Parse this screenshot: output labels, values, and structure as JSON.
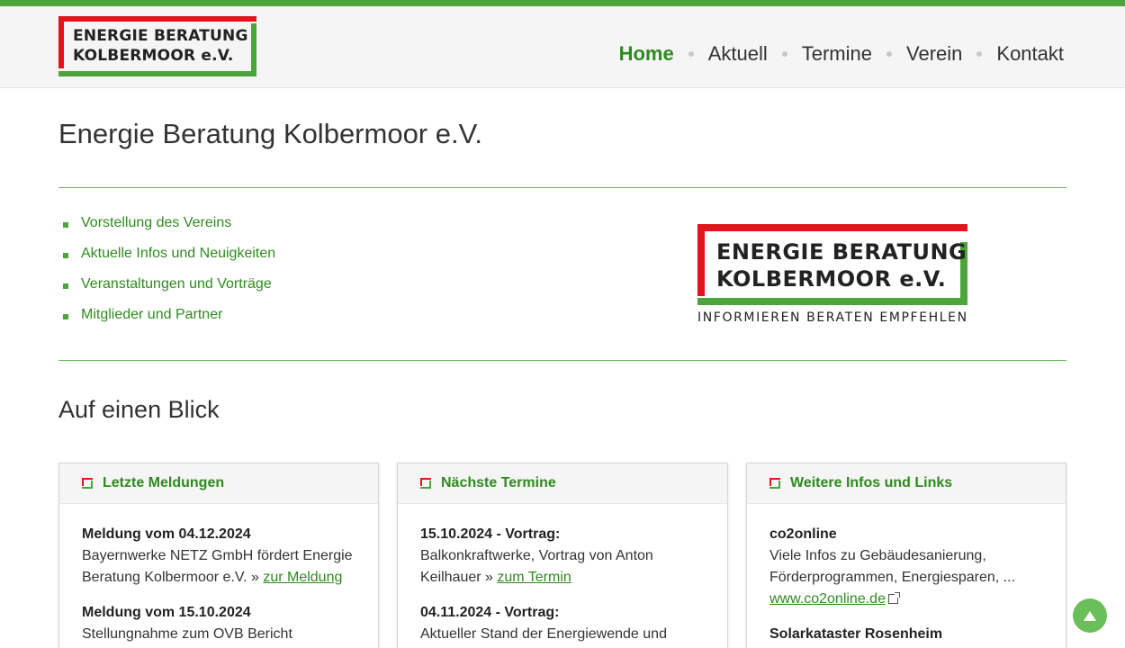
{
  "header": {
    "logo_line1": "ENERGIE BERATUNG",
    "logo_line2": "KOLBERMOOR e.V.",
    "nav": [
      {
        "label": "Home",
        "active": true
      },
      {
        "label": "Aktuell",
        "active": false
      },
      {
        "label": "Termine",
        "active": false
      },
      {
        "label": "Verein",
        "active": false
      },
      {
        "label": "Kontakt",
        "active": false
      }
    ]
  },
  "main": {
    "title": "Energie Beratung Kolbermoor e.V.",
    "intro_links": [
      "Vorstellung des Vereins",
      "Aktuelle Infos und Neuigkeiten",
      "Veranstaltungen und Vorträge",
      "Mitglieder und Partner"
    ],
    "logo": {
      "line1": "ENERGIE BERATUNG",
      "line2": "KOLBERMOOR e.V.",
      "slogan": "INFORMIEREN BERATEN EMPFEHLEN"
    },
    "section_title": "Auf einen Blick"
  },
  "cards": {
    "news": {
      "title": "Letzte Meldungen",
      "entries": [
        {
          "heading": "Meldung vom 04.12.2024",
          "text": "Bayernwerke NETZ GmbH fördert Energie Beratung Kolbermoor e.V. » ",
          "link": "zur Meldung"
        },
        {
          "heading": "Meldung vom 15.10.2024",
          "text": "Stellungnahme zum OVB Bericht"
        }
      ]
    },
    "events": {
      "title": "Nächste Termine",
      "entries": [
        {
          "heading": "15.10.2024 - Vortrag:",
          "text": "Balkonkraftwerke, Vortrag von Anton Keilhauer » ",
          "link": "zum Termin"
        },
        {
          "heading": "04.11.2024 - Vortrag:",
          "text": "Aktueller Stand der Energiewende und"
        }
      ]
    },
    "links": {
      "title": "Weitere Infos und Links",
      "entries": [
        {
          "heading": "co2online",
          "text": "Viele Infos zu Gebäudesanierung, Förderprogrammen, Energiesparen, ...",
          "link": "www.co2online.de"
        },
        {
          "heading": "Solarkataster Rosenheim"
        }
      ]
    }
  },
  "colors": {
    "brand_green": "#4ca53b",
    "link_green": "#2f8a1f",
    "brand_red": "#e2141e"
  },
  "icons": {
    "scroll_top": "arrow-up-icon"
  }
}
